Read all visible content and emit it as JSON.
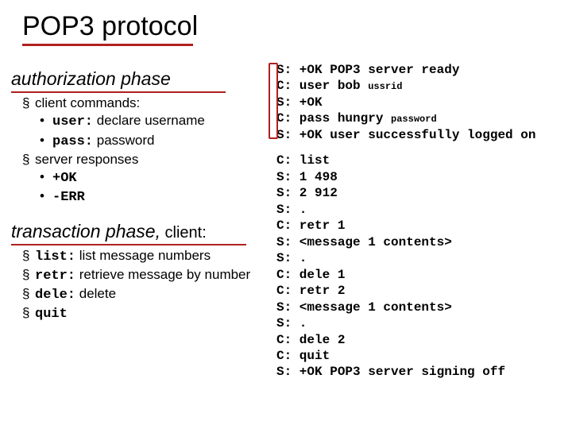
{
  "title": "POP3 protocol",
  "phaseA": {
    "heading": "authorization phase",
    "items": [
      {
        "text": "client commands:",
        "sub": [
          {
            "cmd": "user:",
            "rest": " declare username"
          },
          {
            "cmd": "pass:",
            "rest": " password"
          }
        ]
      },
      {
        "text": "server responses",
        "sub": [
          {
            "cmd": "+OK",
            "rest": ""
          },
          {
            "cmd": "-ERR",
            "rest": ""
          }
        ]
      }
    ]
  },
  "phaseB": {
    "heading": "transaction phase,",
    "headingTail": " client:",
    "items": [
      {
        "cmd": "list:",
        "rest": " list message numbers"
      },
      {
        "cmd": "retr:",
        "rest": " retrieve message by number"
      },
      {
        "cmd": "dele:",
        "rest": " delete"
      },
      {
        "cmd": "quit",
        "rest": ""
      }
    ]
  },
  "transcript": {
    "auth": [
      {
        "line": "S: +OK POP3 server ready"
      },
      {
        "line": "C: user bob ",
        "note": "ussrid"
      },
      {
        "line": "S: +OK"
      },
      {
        "line": "C: pass hungry ",
        "note": "password"
      },
      {
        "line": "S: +OK user successfully logged on"
      }
    ],
    "trans": [
      "C: list",
      "S: 1 498",
      "S: 2 912",
      "S: .",
      "C: retr 1",
      "S: <message 1 contents>",
      "S: .",
      "C: dele 1",
      "C: retr 2",
      "S: <message 1 contents>",
      "S: .",
      "C: dele 2",
      "C: quit",
      "S: +OK POP3 server signing off"
    ]
  }
}
